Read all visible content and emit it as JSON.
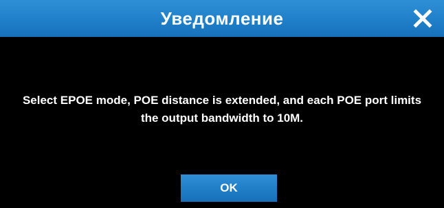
{
  "dialog": {
    "title": "Уведомление",
    "message": "Select EPOE mode, POE distance is extended, and each POE port limits the output bandwidth to 10M.",
    "ok_label": "OK",
    "close_icon": "close-icon"
  },
  "colors": {
    "title_bar": "#1f7fc8",
    "background": "#000000",
    "text": "#ffffff",
    "button": "#1e7cc5"
  }
}
